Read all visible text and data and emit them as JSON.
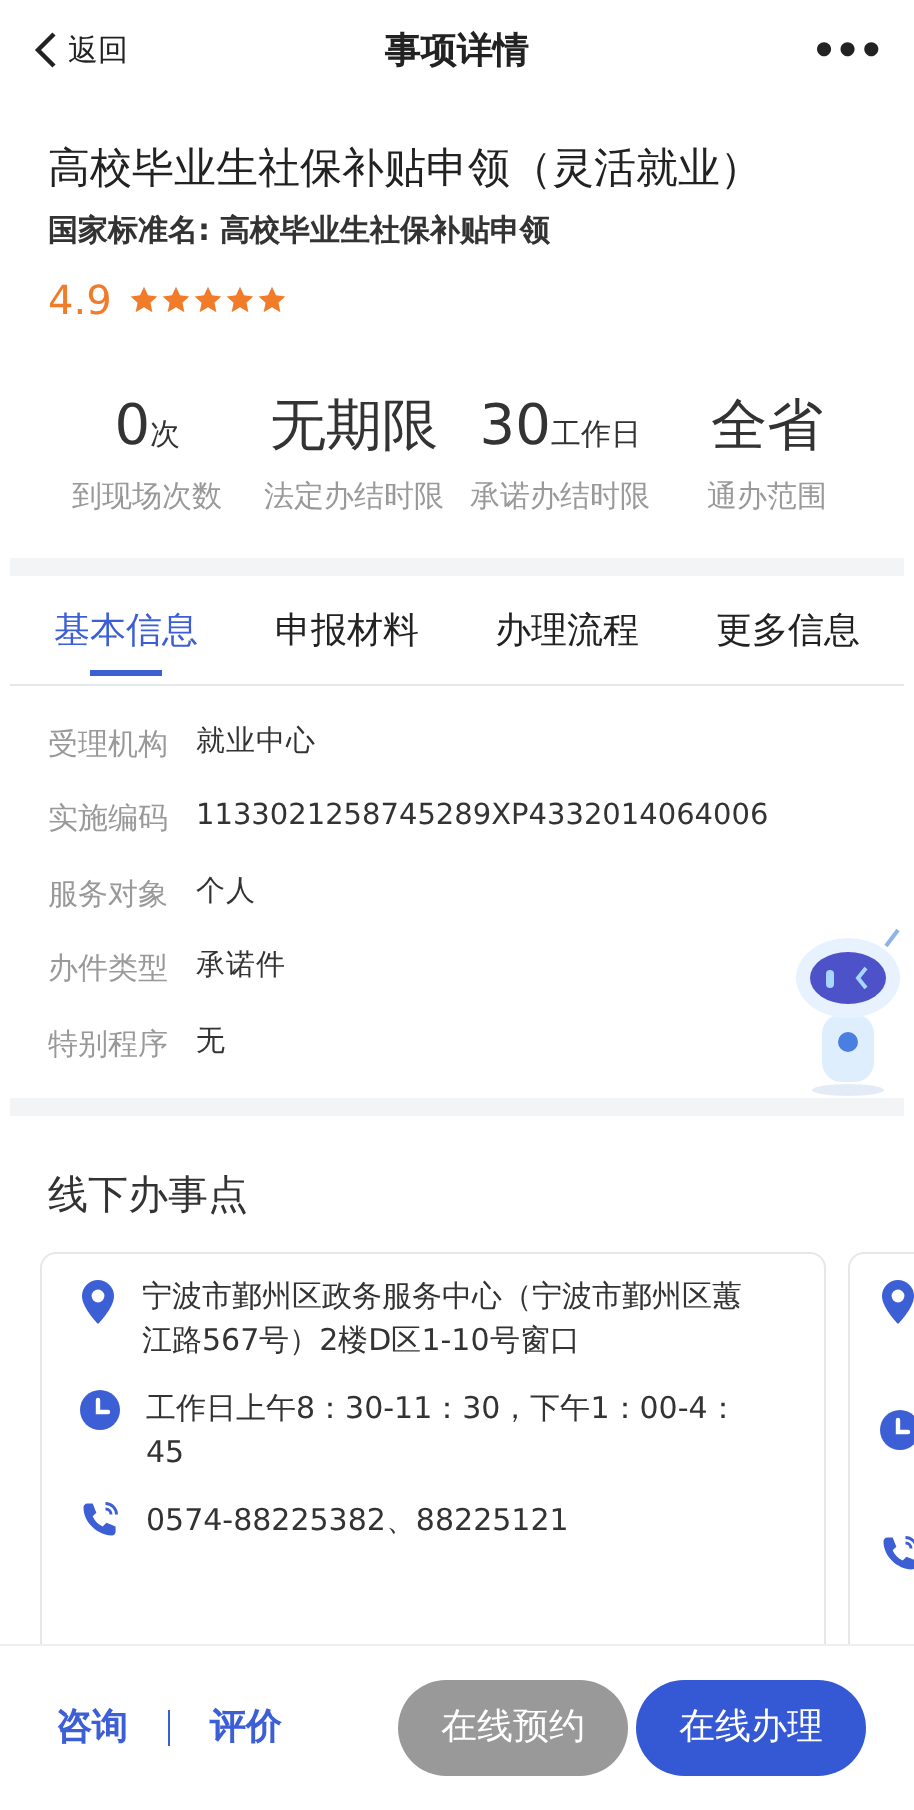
{
  "nav": {
    "back": "返回",
    "title": "事项详情",
    "more": "•••"
  },
  "item": {
    "title": "高校毕业生社保补贴申领（灵活就业）",
    "standard_name": "国家标准名: 高校毕业生社保补贴申领",
    "rating": "4.9",
    "stars": 5
  },
  "stats": [
    {
      "value": "0",
      "unit": "次",
      "label": "到现场次数"
    },
    {
      "value": "无期限",
      "label": "法定办结时限"
    },
    {
      "value": "30",
      "unit": "工作日",
      "label": "承诺办结时限"
    },
    {
      "value": "全省",
      "label": "通办范围"
    }
  ],
  "tabs": [
    {
      "label": "基本信息",
      "selected": true
    },
    {
      "label": "申报材料",
      "selected": false
    },
    {
      "label": "办理流程",
      "selected": false
    },
    {
      "label": "更多信息",
      "selected": false
    }
  ],
  "info": [
    {
      "label": "受理机构",
      "value": "就业中心"
    },
    {
      "label": "实施编码",
      "value": "1133021258745289XP4332014064006"
    },
    {
      "label": "服务对象",
      "value": "个人"
    },
    {
      "label": "办件类型",
      "value": "承诺件"
    },
    {
      "label": "特别程序",
      "value": "无"
    }
  ],
  "offline": {
    "title": "线下办事点",
    "cards": [
      {
        "lines": [
          {
            "kind": "address",
            "text": "宁波市鄞州区政务服务中心（宁波市鄞州区蕙江路567号）2楼D区1-10号窗口"
          },
          {
            "kind": "hours",
            "text": "工作日上午8：30-11：30，下午1：00-4：45"
          },
          {
            "kind": "phone",
            "text": "0574-88225382、88225121"
          }
        ]
      }
    ]
  },
  "bottom": {
    "links": [
      "咨询",
      "评价"
    ],
    "buttons": [
      {
        "label": "在线预约",
        "disabled": true
      },
      {
        "label": "在线办理",
        "disabled": false
      }
    ]
  }
}
